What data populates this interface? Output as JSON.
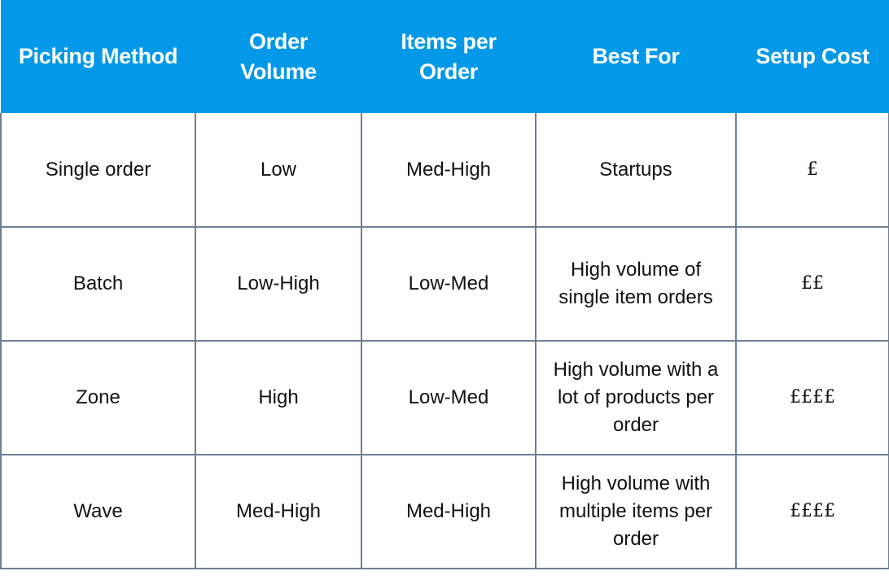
{
  "table": {
    "header_bg": "#0399E8",
    "border_color": "#6E7F94",
    "headers": [
      "Picking Method",
      "Order Volume",
      "Items per Order",
      "Best For",
      "Setup Cost"
    ],
    "rows": [
      {
        "method": "Single order",
        "order_volume": "Low",
        "items_per_order": "Med-High",
        "best_for": "Startups",
        "setup_cost": "£"
      },
      {
        "method": "Batch",
        "order_volume": "Low-High",
        "items_per_order": "Low-Med",
        "best_for": "High volume of single item orders",
        "setup_cost": "££"
      },
      {
        "method": "Zone",
        "order_volume": "High",
        "items_per_order": "Low-Med",
        "best_for": "High volume with a lot of products per order",
        "setup_cost": "££££"
      },
      {
        "method": "Wave",
        "order_volume": "Med-High",
        "items_per_order": "Med-High",
        "best_for": "High volume with multiple items per order",
        "setup_cost": "££££"
      }
    ]
  }
}
